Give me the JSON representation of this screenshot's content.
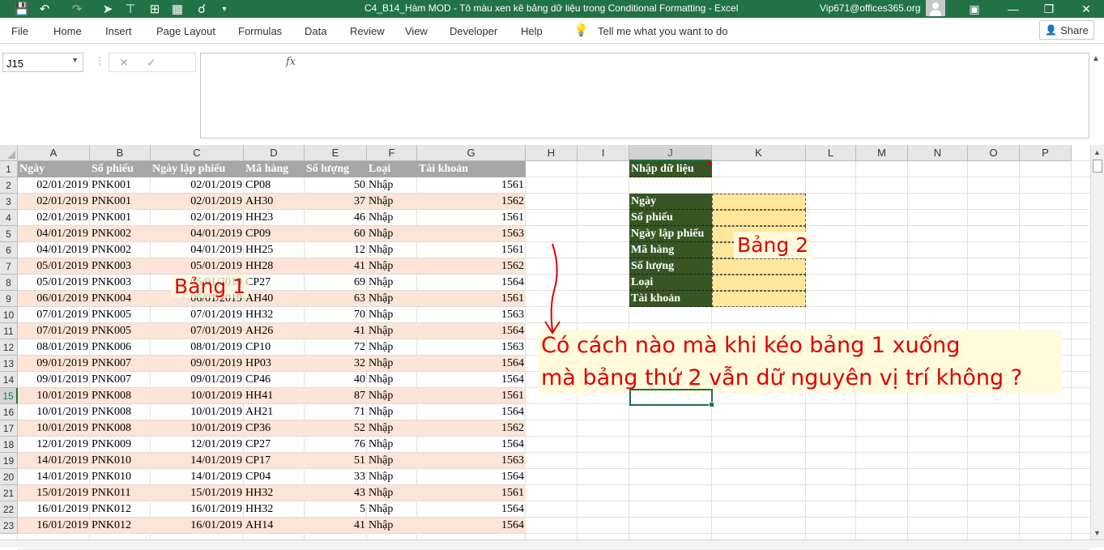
{
  "titlebar": {
    "title": "C4_B14_Hàm MOD - Tô màu xen kẽ bảng dữ liệu trong Conditional Formatting  -  Excel",
    "user": "Vip671@offices365.org"
  },
  "ribbon": {
    "tabs": [
      "File",
      "Home",
      "Insert",
      "Page Layout",
      "Formulas",
      "Data",
      "Review",
      "View",
      "Developer",
      "Help"
    ],
    "tell_me": "Tell me what you want to do",
    "share": "Share"
  },
  "formula_bar": {
    "name_box": "J15",
    "fx": "fx",
    "value": ""
  },
  "columns": [
    "A",
    "B",
    "C",
    "D",
    "E",
    "F",
    "G",
    "H",
    "I",
    "J",
    "K",
    "L",
    "M",
    "N",
    "O",
    "P"
  ],
  "selected_column": "J",
  "selected_row": 15,
  "row_numbers": [
    "1",
    "2",
    "3",
    "4",
    "5",
    "6",
    "7",
    "8",
    "9",
    "10",
    "11",
    "12",
    "13",
    "14",
    "15",
    "16",
    "17",
    "18",
    "19",
    "20",
    "21",
    "22",
    "23"
  ],
  "table1": {
    "headers": [
      "Ngày",
      "Số phiếu",
      "Ngày lập phiếu",
      "Mã hàng",
      "Số lượng",
      "Loại",
      "Tài khoản"
    ],
    "rows": [
      [
        "02/01/2019",
        "PNK001",
        "02/01/2019",
        "CP08",
        "50",
        "Nhập",
        "1561"
      ],
      [
        "02/01/2019",
        "PNK001",
        "02/01/2019",
        "AH30",
        "37",
        "Nhập",
        "1562"
      ],
      [
        "02/01/2019",
        "PNK001",
        "02/01/2019",
        "HH23",
        "46",
        "Nhập",
        "1561"
      ],
      [
        "04/01/2019",
        "PNK002",
        "04/01/2019",
        "CP09",
        "60",
        "Nhập",
        "1563"
      ],
      [
        "04/01/2019",
        "PNK002",
        "04/01/2019",
        "HH25",
        "12",
        "Nhập",
        "1561"
      ],
      [
        "05/01/2019",
        "PNK003",
        "05/01/2019",
        "HH28",
        "41",
        "Nhập",
        "1562"
      ],
      [
        "05/01/2019",
        "PNK003",
        "05/01/2019",
        "CP27",
        "69",
        "Nhập",
        "1564"
      ],
      [
        "06/01/2019",
        "PNK004",
        "06/01/2019",
        "AH40",
        "63",
        "Nhập",
        "1561"
      ],
      [
        "07/01/2019",
        "PNK005",
        "07/01/2019",
        "HH32",
        "70",
        "Nhập",
        "1563"
      ],
      [
        "07/01/2019",
        "PNK005",
        "07/01/2019",
        "AH26",
        "41",
        "Nhập",
        "1564"
      ],
      [
        "08/01/2019",
        "PNK006",
        "08/01/2019",
        "CP10",
        "72",
        "Nhập",
        "1563"
      ],
      [
        "09/01/2019",
        "PNK007",
        "09/01/2019",
        "HP03",
        "32",
        "Nhập",
        "1564"
      ],
      [
        "09/01/2019",
        "PNK007",
        "09/01/2019",
        "CP46",
        "40",
        "Nhập",
        "1564"
      ],
      [
        "10/01/2019",
        "PNK008",
        "10/01/2019",
        "HH41",
        "87",
        "Nhập",
        "1561"
      ],
      [
        "10/01/2019",
        "PNK008",
        "10/01/2019",
        "AH21",
        "71",
        "Nhập",
        "1564"
      ],
      [
        "10/01/2019",
        "PNK008",
        "10/01/2019",
        "CP36",
        "52",
        "Nhập",
        "1562"
      ],
      [
        "12/01/2019",
        "PNK009",
        "12/01/2019",
        "CP27",
        "76",
        "Nhập",
        "1564"
      ],
      [
        "14/01/2019",
        "PNK010",
        "14/01/2019",
        "CP17",
        "51",
        "Nhập",
        "1563"
      ],
      [
        "14/01/2019",
        "PNK010",
        "14/01/2019",
        "CP04",
        "33",
        "Nhập",
        "1564"
      ],
      [
        "15/01/2019",
        "PNK011",
        "15/01/2019",
        "HH32",
        "43",
        "Nhập",
        "1561"
      ],
      [
        "16/01/2019",
        "PNK012",
        "16/01/2019",
        "HH32",
        "5",
        "Nhập",
        "1564"
      ],
      [
        "16/01/2019",
        "PNK012",
        "16/01/2019",
        "AH14",
        "41",
        "Nhập",
        "1564"
      ]
    ]
  },
  "table2": {
    "title": "Nhập dữ liệu",
    "labels": [
      "Ngày",
      "Số phiếu",
      "Ngày lập phiếu",
      "Mã hàng",
      "Số lượng",
      "Loại",
      "Tài khoản"
    ]
  },
  "annotations": {
    "bang1": "Bảng 1",
    "bang2": "Bảng 2",
    "question_line1": "Có cách nào mà khi kéo bảng 1 xuống",
    "question_line2": "mà bảng thứ 2 vẫn dữ nguyên vị trí không ?"
  },
  "colors": {
    "excel_green": "#217346",
    "header_gray": "#a6a6a6",
    "band_pink": "#fce4d6",
    "label_green": "#375623",
    "input_yellow": "#ffe699",
    "annotation_red": "#e00000",
    "annotation_bg": "#fffbdc"
  }
}
